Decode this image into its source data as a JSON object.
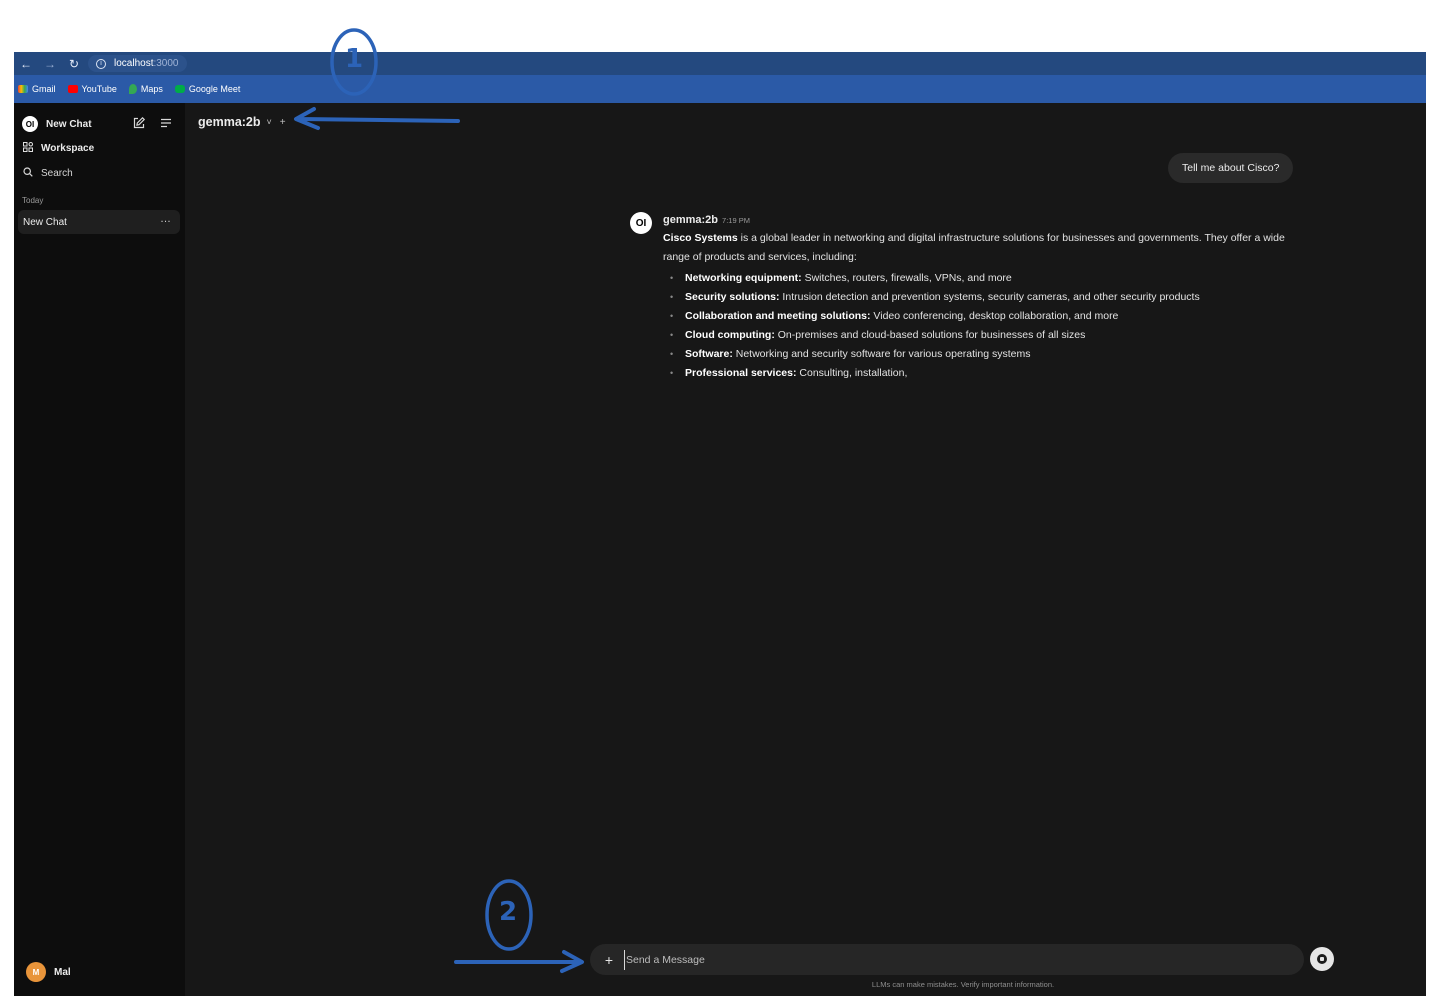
{
  "browser": {
    "url_host": "localhost",
    "url_port": ":3000",
    "bookmarks": [
      "Gmail",
      "YouTube",
      "Maps",
      "Google Meet"
    ]
  },
  "sidebar": {
    "new_chat": "New Chat",
    "workspace": "Workspace",
    "search": "Search",
    "section_today": "Today",
    "chat_items": [
      "New Chat"
    ],
    "chat_menu": "…",
    "user": {
      "initial": "M",
      "name": "Mal"
    },
    "logo_text": "OI"
  },
  "main": {
    "model_name": "gemma:2b",
    "model_chevron": "˅",
    "model_add": "+"
  },
  "conversation": {
    "user_message": "Tell me about Cisco?",
    "bot_name": "gemma:2b",
    "bot_time": "7:19 PM",
    "intro_bold": "Cisco Systems",
    "intro_text": " is a global leader in networking and digital infrastructure solutions for businesses and governments. They offer a wide range of products and services, including:",
    "items": [
      {
        "bold": "Networking equipment:",
        "text": " Switches, routers, firewalls, VPNs, and more"
      },
      {
        "bold": "Security solutions:",
        "text": " Intrusion detection and prevention systems, security cameras, and other security products"
      },
      {
        "bold": "Collaboration and meeting solutions:",
        "text": " Video conferencing, desktop collaboration, and more"
      },
      {
        "bold": "Cloud computing:",
        "text": " On-premises and cloud-based solutions for businesses of all sizes"
      },
      {
        "bold": "Software:",
        "text": " Networking and security software for various operating systems"
      },
      {
        "bold": "Professional services:",
        "text": " Consulting, installation,"
      }
    ]
  },
  "composer": {
    "attach": "+",
    "placeholder": "Send a Message",
    "disclaimer": "LLMs can make mistakes. Verify important information."
  },
  "annotations": {
    "label_1": "1",
    "label_2": "2",
    "color": "#2c63b8"
  }
}
